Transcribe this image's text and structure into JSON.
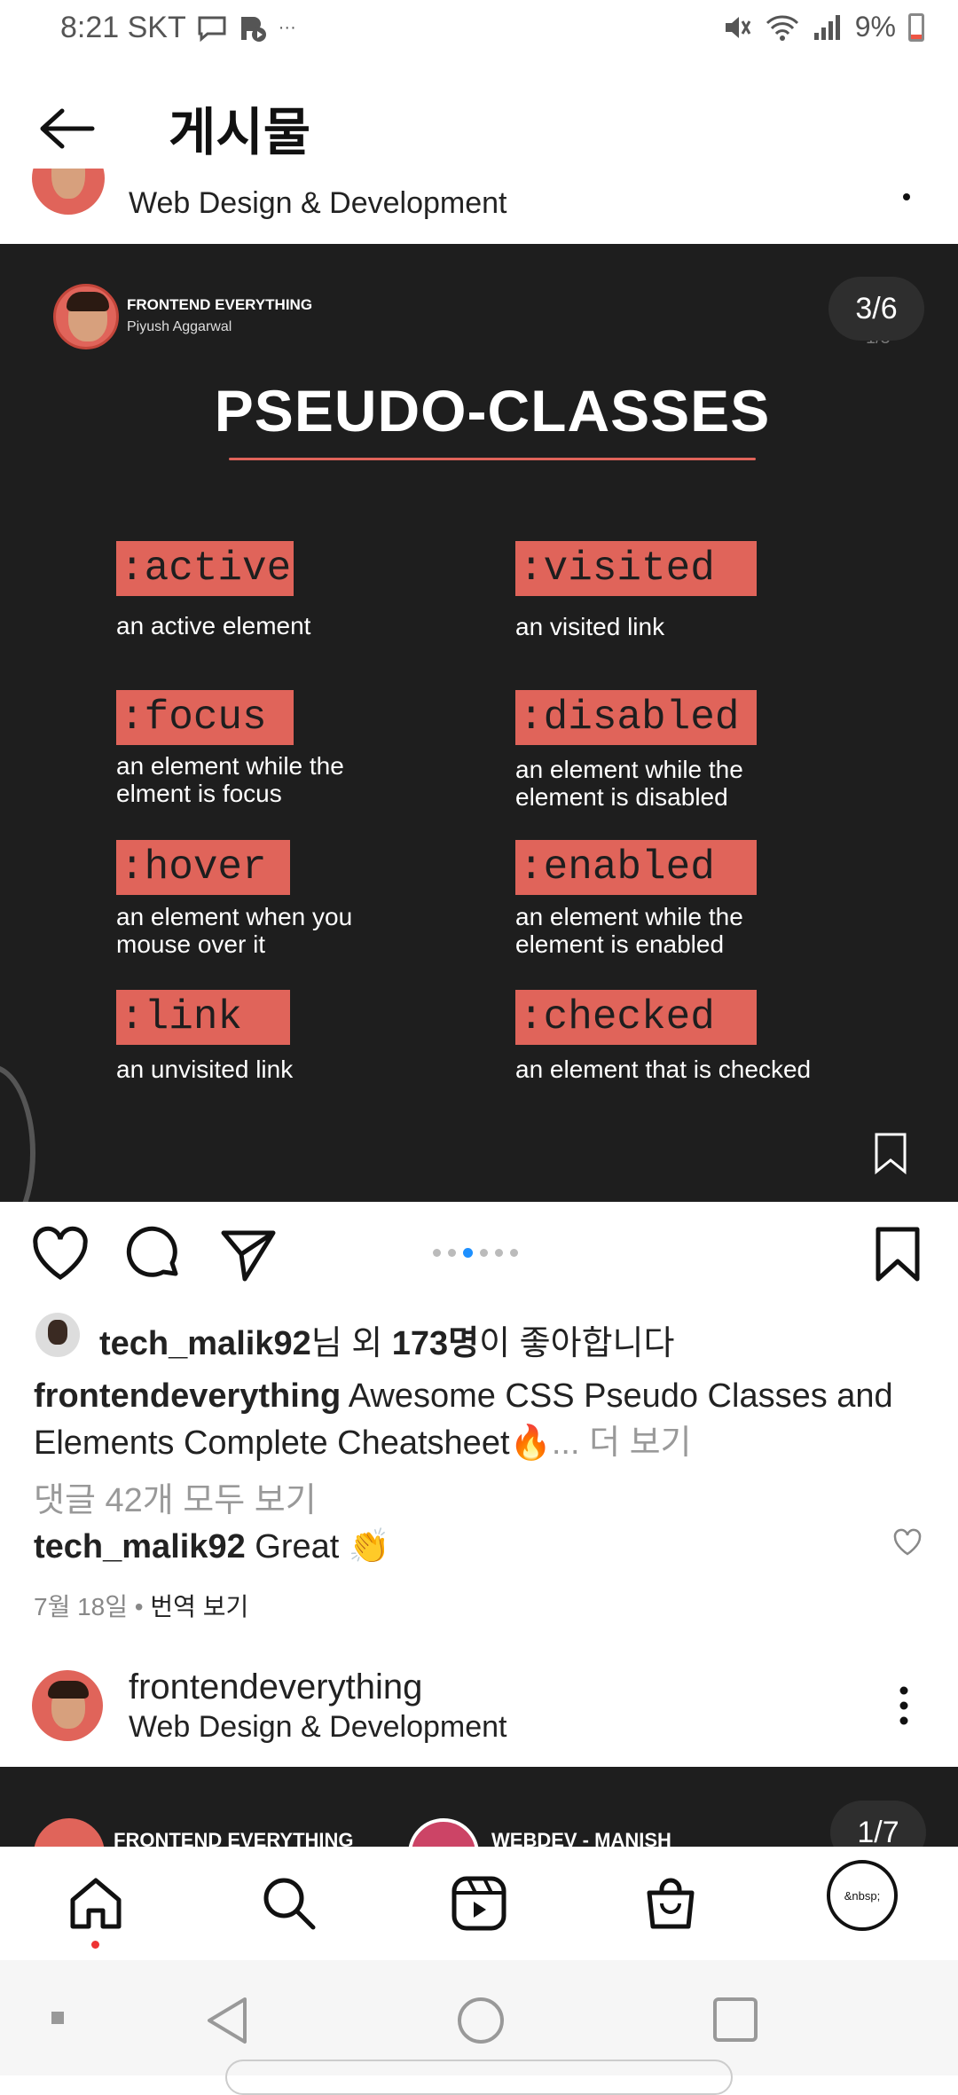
{
  "status_bar": {
    "time": "8:21 SKT",
    "extra": "···",
    "battery": "9%"
  },
  "header": {
    "title": "게시물"
  },
  "top_post": {
    "author_subtitle": "Web Design & Development"
  },
  "post_image": {
    "brand_name": "FRONTEND EVERYTHING",
    "brand_sub": "Piyush Aggarwal",
    "counter": "3/6",
    "counter_sub": "1/5",
    "heading": "PSEUDO-CLASSES",
    "items": [
      {
        "tag": ":active",
        "desc": "an active element"
      },
      {
        "tag": ":visited",
        "desc": "an visited link"
      },
      {
        "tag": ":focus",
        "desc": "an element while the elment is focus"
      },
      {
        "tag": ":disabled",
        "desc": "an element while the element is disabled"
      },
      {
        "tag": ":hover",
        "desc": "an element when you mouse over it"
      },
      {
        "tag": ":enabled",
        "desc": "an element while the element is enabled"
      },
      {
        "tag": ":link",
        "desc": "an unvisited link"
      },
      {
        "tag": ":checked",
        "desc": "an element that is checked"
      }
    ],
    "accent_color": "#e0645a",
    "background_color": "#1e1e1e"
  },
  "carousel": {
    "total": 6,
    "active_index": 2
  },
  "likes": {
    "user": "tech_malik92",
    "middle": "님 외 ",
    "count": "173명",
    "suffix": "이 좋아합니다"
  },
  "caption": {
    "username": "frontendeverything",
    "text": " Awesome CSS Pseudo Classes and Elements Complete Cheatsheet",
    "emoji": "🔥",
    "more": "... 더 보기"
  },
  "comments_link": "댓글 42개 모두 보기",
  "comment": {
    "username": "tech_malik92",
    "text": " Great ",
    "emoji": "👏"
  },
  "meta": {
    "date": "7월 18일",
    "separator": " • ",
    "translate": "번역 보기"
  },
  "second_post": {
    "author": "frontendeverything",
    "author_subtitle": "Web Design & Development",
    "peek_text_1": "FRONTEND EVERYTHING",
    "peek_text_2": "WEBDEV - MANISH",
    "counter": "1/7"
  },
  "bottom_nav": {
    "items": [
      "home-icon",
      "search-icon",
      "reels-icon",
      "shop-icon",
      "profile"
    ],
    "profile_label": "&nbsp;"
  },
  "icons": {
    "status": [
      "chat-icon",
      "media-icon",
      "mute-icon",
      "wifi-icon",
      "signal-icon",
      "battery-icon"
    ],
    "system_nav": [
      "back-triangle-icon",
      "home-circle-icon",
      "recents-square-icon"
    ]
  }
}
